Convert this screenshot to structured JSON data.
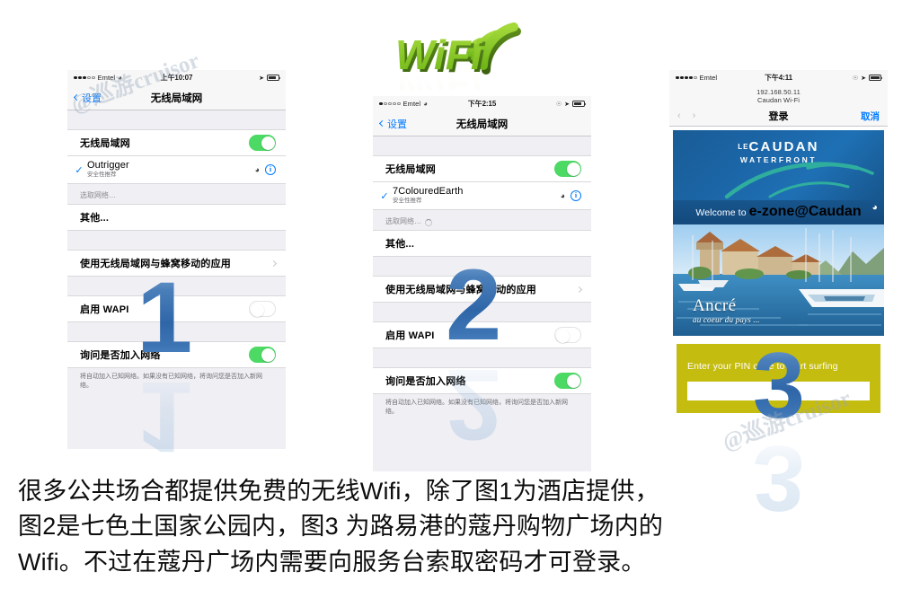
{
  "logo": {
    "text": "WiFi",
    "alt": "wifi-3d-logo",
    "color": "#86c232"
  },
  "phone1": {
    "status": {
      "carrier": "Emtel",
      "time": "上午10:07",
      "signal_dots": 5,
      "signal_filled": 3,
      "wifi_icon": "wifi-icon",
      "battery": "battery-icon",
      "location_icon": "location-arrow-icon"
    },
    "nav": {
      "back": "设置",
      "title": "无线局域网"
    },
    "wifi_row": {
      "label": "无线局域网",
      "toggle": "on"
    },
    "network": {
      "name": "Outrigger",
      "sub": "安全性推荐",
      "checked": true,
      "signal": "wifi-icon",
      "info": "i"
    },
    "choose_header": "选取网络…",
    "other": "其他...",
    "apps_row": {
      "label": "使用无线局域网与蜂窝移动的应用",
      "chevron": ">"
    },
    "wapi_row": {
      "label": "启用 WAPI",
      "toggle": "off"
    },
    "ask_row": {
      "label": "询问是否加入网络",
      "toggle": "on"
    },
    "footnote": "将自动加入已知网络。如果没有已知网络，将询问您是否加入新网络。",
    "badge": "1"
  },
  "phone2": {
    "status": {
      "carrier": "Emtel",
      "time": "下午2:15",
      "signal_dots": 5,
      "signal_filled": 1,
      "wifi_icon": "wifi-icon",
      "battery": "battery-icon",
      "location_icon": "location-arrow-icon",
      "lock_icon": "rotation-lock-icon"
    },
    "nav": {
      "back": "设置",
      "title": "无线局域网"
    },
    "wifi_row": {
      "label": "无线局域网",
      "toggle": "on"
    },
    "network": {
      "name": "7ColouredEarth",
      "sub": "安全性推荐",
      "checked": true,
      "signal": "wifi-icon",
      "info": "i"
    },
    "choose_header": "选取网络…",
    "other": "其他...",
    "apps_row": {
      "label": "使用无线局域网与蜂窝移动的应用",
      "chevron": ">"
    },
    "wapi_row": {
      "label": "启用 WAPI",
      "toggle": "off"
    },
    "ask_row": {
      "label": "询问是否加入网络",
      "toggle": "on"
    },
    "footnote": "将自动加入已知网络。如果没有已知网络，将询问您是否加入新网络。",
    "badge": "2"
  },
  "phone3": {
    "status": {
      "carrier": "Emtel",
      "time": "下午4:11",
      "signal_dots": 5,
      "signal_filled": 4,
      "battery": "battery-icon",
      "location_icon": "location-arrow-icon",
      "lock_icon": "rotation-lock-icon"
    },
    "url": "192.168.50.11",
    "host": "Caudan Wi-Fi",
    "nav": {
      "back_icon": "chevron-left-icon",
      "forward_icon": "chevron-right-icon",
      "title": "登录",
      "cancel": "取消"
    },
    "banner": {
      "brand_small": "LE",
      "brand_main": "CAUDAN",
      "brand_sub": "WATERFRONT",
      "welcome_prefix": "Welcome to ",
      "welcome_strong": "e-zone@Caudan",
      "wifi_icon": "wifi-icon",
      "tagline_main": "Ancré",
      "tagline_sub": "au coeur du pays ...",
      "brand_blue": "#1a5c96",
      "swoosh_teal": "#2fae9e"
    },
    "pin": {
      "label": "Enter your PIN code to start surfing",
      "value": "",
      "placeholder": "",
      "panel_color": "#c5bc10"
    },
    "badge": "3"
  },
  "watermark": {
    "text": "@巡游cruisor"
  },
  "caption": {
    "line1": "很多公共场合都提供免费的无线Wifi，除了图1为酒店提供，",
    "line2": "图2是七色土国家公园内，图3 为路易港的蔻丹购物广场内的",
    "line3": "Wifi。不过在蔻丹广场内需要向服务台索取密码才可登录。"
  }
}
